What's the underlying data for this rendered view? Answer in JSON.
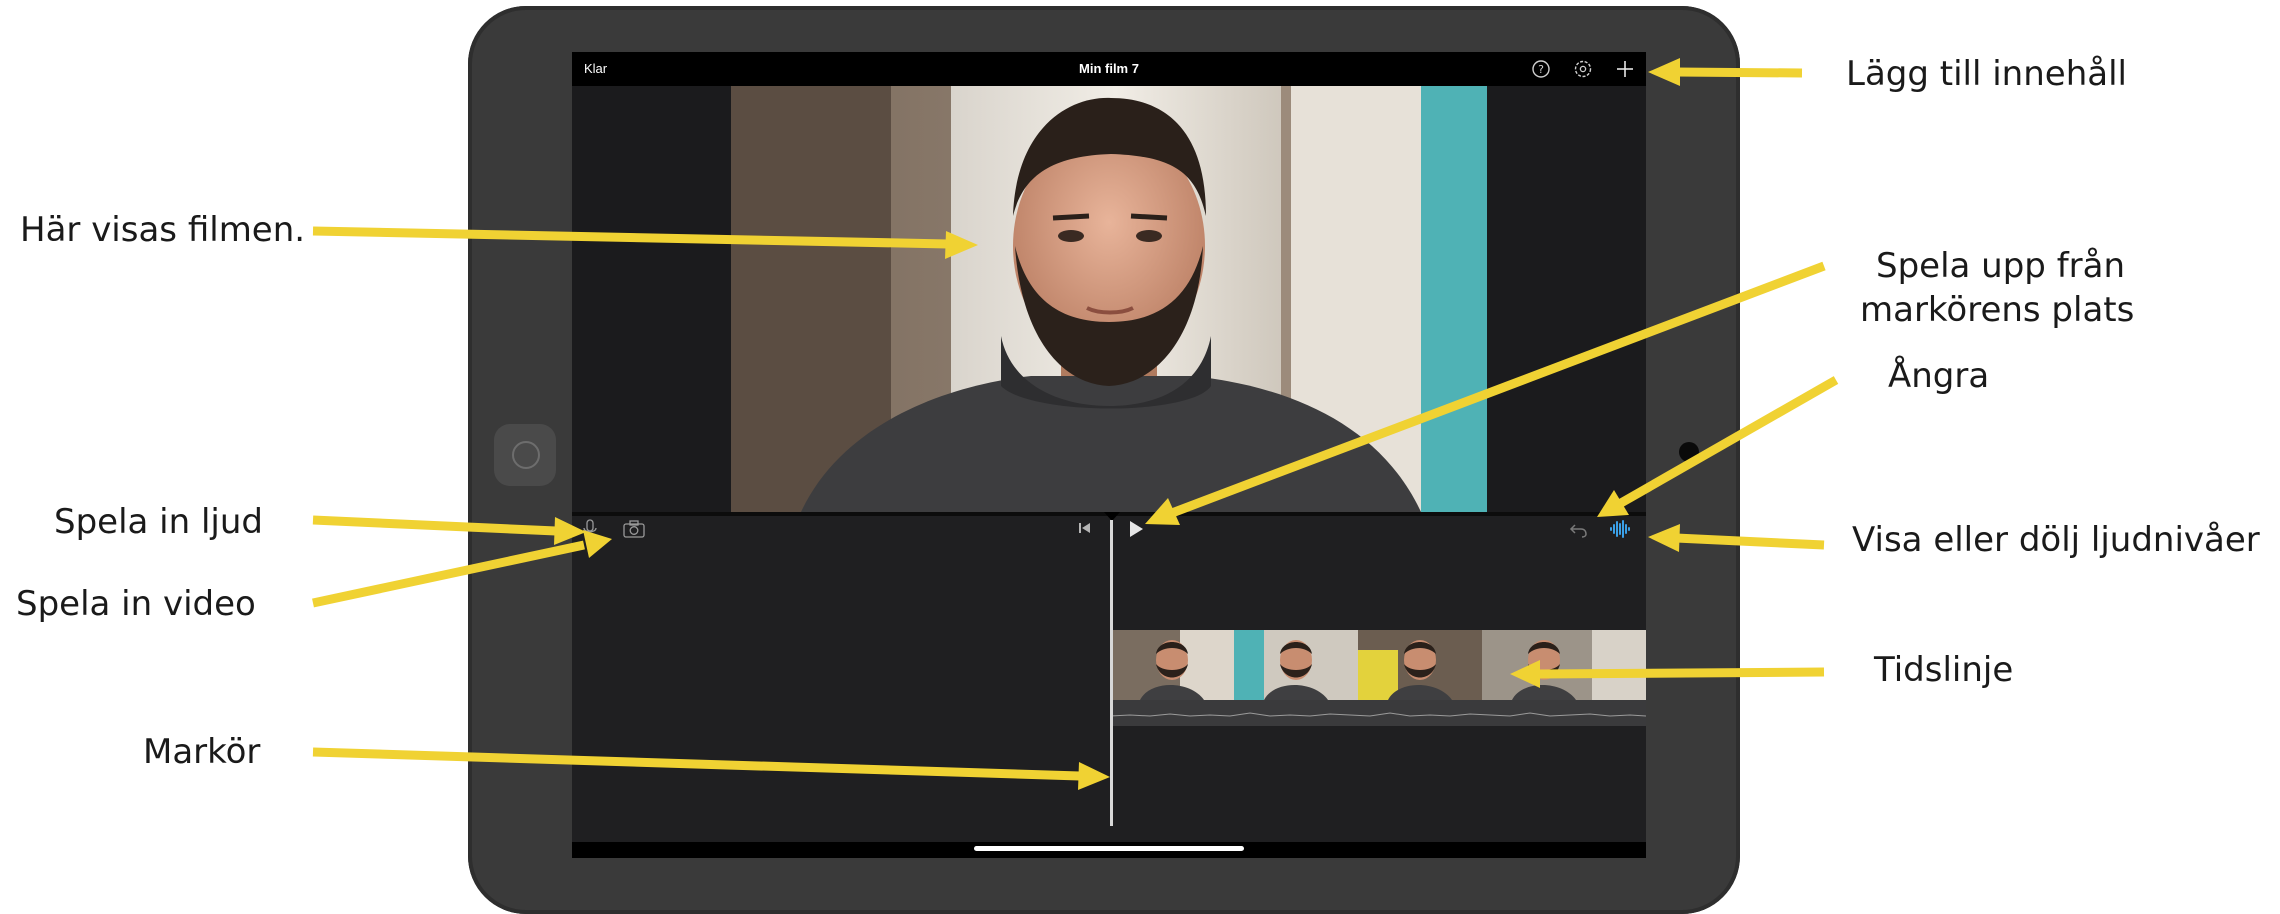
{
  "app": {
    "done_label": "Klar",
    "project_title": "Min film 7"
  },
  "toolbar": {
    "icons": [
      "help-icon",
      "settings-icon",
      "add-icon"
    ]
  },
  "editor": {
    "icons": [
      "microphone-icon",
      "camera-icon",
      "skip-back-icon",
      "play-icon",
      "undo-icon",
      "audio-waveform-icon"
    ]
  },
  "annotations": {
    "add_content": "Lägg till innehåll",
    "movie_shown": "Här visas filmen.",
    "play_from_cursor": [
      "Spela upp från",
      "markörens plats"
    ],
    "undo": "Ångra",
    "record_audio": "Spela in ljud",
    "record_video": "Spela in video",
    "show_hide_audio": "Visa eller dölj ljudnivåer",
    "timeline": "Tidslinje",
    "cursor": "Markör"
  },
  "colors": {
    "arrow": "#f0d233",
    "screen_bg": "#1f1f21",
    "frame": "#3a3a3a",
    "accent_audio": "#3aa0e8"
  }
}
